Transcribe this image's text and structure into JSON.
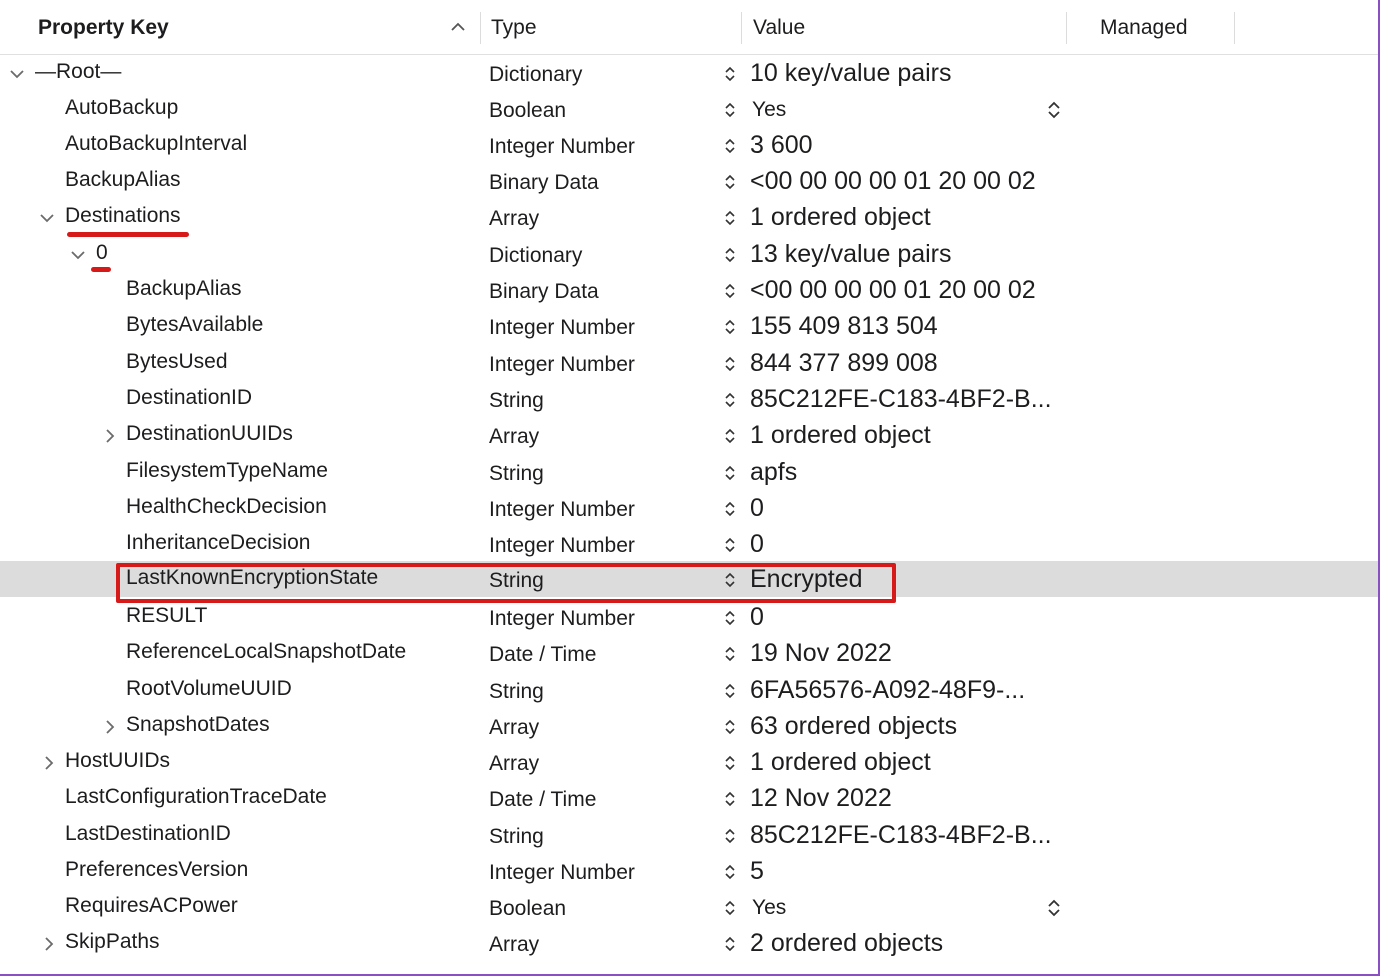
{
  "header": {
    "property_key": "Property Key",
    "type": "Type",
    "value": "Value",
    "managed": "Managed"
  },
  "rows": [
    {
      "key": "—Root—",
      "type": "Dictionary",
      "value": "10 key/value pairs"
    },
    {
      "key": "AutoBackup",
      "type": "Boolean",
      "value": "Yes"
    },
    {
      "key": "AutoBackupInterval",
      "type": "Integer Number",
      "value": "3 600"
    },
    {
      "key": "BackupAlias",
      "type": "Binary Data",
      "value": "<00 00 00 00 01 20 00 02"
    },
    {
      "key": "Destinations",
      "type": "Array",
      "value": "1 ordered object"
    },
    {
      "key": "0",
      "type": "Dictionary",
      "value": "13 key/value pairs"
    },
    {
      "key": "BackupAlias",
      "type": "Binary Data",
      "value": "<00 00 00 00 01 20 00 02"
    },
    {
      "key": "BytesAvailable",
      "type": "Integer Number",
      "value": "155 409 813 504"
    },
    {
      "key": "BytesUsed",
      "type": "Integer Number",
      "value": "844 377 899 008"
    },
    {
      "key": "DestinationID",
      "type": "String",
      "value": "85C212FE-C183-4BF2-B..."
    },
    {
      "key": "DestinationUUIDs",
      "type": "Array",
      "value": "1 ordered object"
    },
    {
      "key": "FilesystemTypeName",
      "type": "String",
      "value": "apfs"
    },
    {
      "key": "HealthCheckDecision",
      "type": "Integer Number",
      "value": "0"
    },
    {
      "key": "InheritanceDecision",
      "type": "Integer Number",
      "value": "0"
    },
    {
      "key": "LastKnownEncryptionState",
      "type": "String",
      "value": "Encrypted"
    },
    {
      "key": "RESULT",
      "type": "Integer Number",
      "value": "0"
    },
    {
      "key": "ReferenceLocalSnapshotDate",
      "type": "Date / Time",
      "value": "19 Nov 2022"
    },
    {
      "key": "RootVolumeUUID",
      "type": "String",
      "value": "6FA56576-A092-48F9-..."
    },
    {
      "key": "SnapshotDates",
      "type": "Array",
      "value": "63 ordered objects"
    },
    {
      "key": "HostUUIDs",
      "type": "Array",
      "value": "1 ordered object"
    },
    {
      "key": "LastConfigurationTraceDate",
      "type": "Date / Time",
      "value": "12 Nov 2022"
    },
    {
      "key": "LastDestinationID",
      "type": "String",
      "value": "85C212FE-C183-4BF2-B..."
    },
    {
      "key": "PreferencesVersion",
      "type": "Integer Number",
      "value": "5"
    },
    {
      "key": "RequiresACPower",
      "type": "Boolean",
      "value": "Yes"
    },
    {
      "key": "SkipPaths",
      "type": "Array",
      "value": "2 ordered objects"
    }
  ],
  "colors": {
    "selection": "#dcdcdc",
    "annotation_red": "#d61a1a",
    "text": "#1d1d1f"
  }
}
